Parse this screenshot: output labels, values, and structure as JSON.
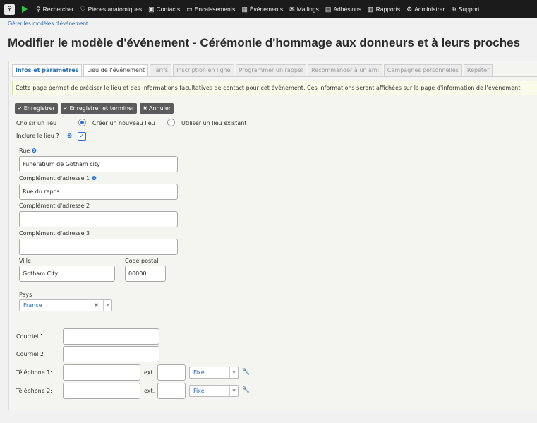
{
  "topbar": {
    "nav": [
      {
        "icon": "search-icon",
        "glyph": "⚲",
        "label": "Rechercher"
      },
      {
        "icon": "heart-icon",
        "glyph": "♡",
        "label": "Pièces anatomiques"
      },
      {
        "icon": "address-book-icon",
        "glyph": "▣",
        "label": "Contacts"
      },
      {
        "icon": "credit-card-icon",
        "glyph": "▭",
        "label": "Encaissements"
      },
      {
        "icon": "calendar-icon",
        "glyph": "▦",
        "label": "Événements"
      },
      {
        "icon": "envelope-icon",
        "glyph": "✉",
        "label": "Mailings"
      },
      {
        "icon": "id-card-icon",
        "glyph": "▤",
        "label": "Adhésions"
      },
      {
        "icon": "chart-icon",
        "glyph": "▥",
        "label": "Rapports"
      },
      {
        "icon": "gears-icon",
        "glyph": "⚙",
        "label": "Administrer"
      },
      {
        "icon": "lifebuoy-icon",
        "glyph": "⊕",
        "label": "Support"
      }
    ]
  },
  "breadcrumb": "Gérer les modèles d'événement",
  "page_title": "Modifier le modèle d'événement - Cérémonie d'hommage aux donneurs et à leurs proches",
  "tabs": [
    {
      "label": "Infos et paramètres"
    },
    {
      "label": "Lieu de l'événement"
    },
    {
      "label": "Tarifs"
    },
    {
      "label": "Inscription en ligne"
    },
    {
      "label": "Programmer un rappel"
    },
    {
      "label": "Recommander à un ami"
    },
    {
      "label": "Campagnes personnelles"
    },
    {
      "label": "Répéter"
    }
  ],
  "info_text": "Cette page permet de préciser le lieu et des informations facultatives de contact pour cet événement. Ces informations seront affichées sur la page d'information de l'événement.",
  "actions": {
    "save": "Enregistrer",
    "save_done": "Enregistrer et terminer",
    "cancel": "Annuler"
  },
  "form": {
    "choose_location_label": "Choisir un lieu",
    "opt_new": "Créer un nouveau lieu",
    "opt_existing": "Utiliser un lieu existant",
    "include_label": "Inclure le lieu ?",
    "street_label": "Rue",
    "street_value": "Funératium de Gotham city",
    "addr1_label": "Complément d'adresse 1",
    "addr1_value": "Rue du repos",
    "addr2_label": "Complément d'adresse 2",
    "addr2_value": "",
    "addr3_label": "Complément d'adresse 3",
    "addr3_value": "",
    "city_label": "Ville",
    "city_value": "Gotham City",
    "postal_label": "Code postal",
    "postal_value": "00000",
    "country_label": "Pays",
    "country_value": "France",
    "email1_label": "Courriel 1",
    "email2_label": "Courriel 2",
    "phone1_label": "Téléphone 1:",
    "phone2_label": "Téléphone 2:",
    "ext_label": "ext.",
    "phone_type": "Fixe"
  },
  "colors": {
    "accent": "#2a6fd6",
    "nav_bg": "#1b1b1b",
    "link": "#2a6fb5"
  }
}
